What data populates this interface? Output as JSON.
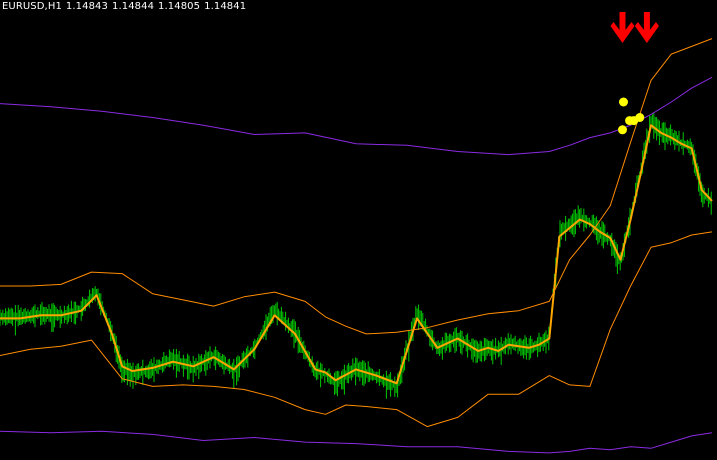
{
  "header": {
    "symbol_timeframe": "EURUSD,H1",
    "open": "1.14843",
    "high": "1.14844",
    "low": "1.14805",
    "close": "1.14841"
  },
  "colors": {
    "background": "#000000",
    "text": "#ffffff",
    "candles": "#00c800",
    "moving_average": "#ffa500",
    "inner_band": "#ff8c00",
    "outer_band": "#8a2be2",
    "dots": "#ffff00",
    "arrows": "#ff0000"
  },
  "chart_data": {
    "type": "line",
    "instrument": "EURUSD",
    "timeframe": "H1",
    "ylim": [
      1.1275,
      1.157
    ],
    "x_units": "bar index (H1 bars)",
    "xlim": [
      0,
      140
    ],
    "grid": false,
    "legend": "none",
    "series": [
      {
        "role": "price",
        "color": "#00c800",
        "x": [
          0,
          4,
          8,
          12,
          16,
          19,
          22,
          24,
          26,
          30,
          34,
          38,
          42,
          46,
          50,
          54,
          58,
          62,
          64,
          66,
          70,
          74,
          78,
          82,
          86,
          90,
          94,
          96,
          98,
          100,
          104,
          106,
          108,
          110,
          114,
          116,
          118,
          120,
          122,
          124,
          126,
          128,
          130,
          132,
          134,
          136,
          138,
          140
        ],
        "values": [
          1.1365,
          1.1365,
          1.1367,
          1.1366,
          1.137,
          1.1381,
          1.1355,
          1.1332,
          1.1328,
          1.1331,
          1.1338,
          1.1332,
          1.134,
          1.133,
          1.1345,
          1.137,
          1.1355,
          1.133,
          1.1328,
          1.1322,
          1.1332,
          1.1326,
          1.132,
          1.1368,
          1.1344,
          1.1352,
          1.1342,
          1.1345,
          1.1343,
          1.1348,
          1.1345,
          1.1347,
          1.1352,
          1.142,
          1.143,
          1.1426,
          1.142,
          1.1415,
          1.14,
          1.143,
          1.146,
          1.1492,
          1.1484,
          1.1482,
          1.1477,
          1.1475,
          1.1445,
          1.1439
        ]
      },
      {
        "role": "moving-average",
        "color": "#ffa500",
        "x": [
          0,
          4,
          8,
          12,
          16,
          19,
          22,
          24,
          26,
          30,
          34,
          38,
          42,
          46,
          50,
          54,
          58,
          62,
          64,
          66,
          70,
          74,
          78,
          82,
          86,
          90,
          94,
          96,
          98,
          100,
          104,
          106,
          108,
          110,
          114,
          116,
          118,
          120,
          122,
          124,
          126,
          128,
          130,
          132,
          134,
          136,
          138,
          140
        ],
        "values": [
          1.1364,
          1.1364,
          1.1366,
          1.1366,
          1.1369,
          1.1379,
          1.1354,
          1.1333,
          1.133,
          1.1332,
          1.1336,
          1.1333,
          1.1339,
          1.1331,
          1.1344,
          1.1366,
          1.1354,
          1.1331,
          1.1329,
          1.1324,
          1.1331,
          1.1327,
          1.1322,
          1.1364,
          1.1345,
          1.1351,
          1.1343,
          1.1345,
          1.1343,
          1.1347,
          1.1345,
          1.1347,
          1.1351,
          1.1417,
          1.1428,
          1.1425,
          1.142,
          1.1416,
          1.1402,
          1.1428,
          1.1458,
          1.1489,
          1.1484,
          1.1481,
          1.1477,
          1.1474,
          1.1447,
          1.144
        ]
      },
      {
        "role": "inner-band-upper",
        "color": "#ff8c00",
        "x": [
          0,
          6,
          12,
          18,
          24,
          30,
          36,
          42,
          48,
          54,
          60,
          64,
          68,
          72,
          78,
          84,
          90,
          96,
          102,
          108,
          112,
          116,
          120,
          124,
          128,
          132,
          136,
          140
        ],
        "values": [
          1.1385,
          1.1385,
          1.1386,
          1.1394,
          1.1393,
          1.138,
          1.1376,
          1.1372,
          1.1378,
          1.1381,
          1.1375,
          1.1365,
          1.1359,
          1.1354,
          1.1355,
          1.1358,
          1.1363,
          1.1367,
          1.1369,
          1.1375,
          1.1402,
          1.1418,
          1.1437,
          1.1478,
          1.1518,
          1.1535,
          1.154,
          1.1545
        ]
      },
      {
        "role": "inner-band-lower",
        "color": "#ff8c00",
        "x": [
          0,
          6,
          12,
          18,
          24,
          30,
          36,
          42,
          48,
          54,
          60,
          64,
          68,
          72,
          78,
          84,
          90,
          96,
          102,
          108,
          112,
          116,
          120,
          124,
          128,
          132,
          136,
          140
        ],
        "values": [
          1.134,
          1.1344,
          1.1346,
          1.135,
          1.1325,
          1.132,
          1.1321,
          1.132,
          1.1318,
          1.1313,
          1.1305,
          1.1302,
          1.1308,
          1.1307,
          1.1305,
          1.1294,
          1.13,
          1.1315,
          1.1315,
          1.1327,
          1.1321,
          1.132,
          1.1357,
          1.1385,
          1.141,
          1.1413,
          1.1418,
          1.142
        ]
      },
      {
        "role": "outer-band-upper",
        "color": "#8a2be2",
        "x": [
          0,
          10,
          20,
          30,
          40,
          50,
          60,
          70,
          80,
          90,
          100,
          108,
          112,
          116,
          120,
          124,
          128,
          132,
          136,
          140
        ],
        "values": [
          1.1503,
          1.1501,
          1.1498,
          1.1494,
          1.1489,
          1.1483,
          1.1484,
          1.1477,
          1.1476,
          1.1472,
          1.147,
          1.1472,
          1.1476,
          1.1481,
          1.1484,
          1.1489,
          1.1496,
          1.1504,
          1.1513,
          1.152
        ]
      },
      {
        "role": "outer-band-lower",
        "color": "#8a2be2",
        "x": [
          0,
          10,
          20,
          30,
          40,
          50,
          60,
          70,
          80,
          90,
          100,
          108,
          112,
          116,
          120,
          124,
          128,
          132,
          136,
          140
        ],
        "values": [
          1.1291,
          1.129,
          1.1291,
          1.1289,
          1.1285,
          1.1287,
          1.1284,
          1.1283,
          1.1281,
          1.1281,
          1.1278,
          1.1277,
          1.1278,
          1.128,
          1.1279,
          1.1281,
          1.128,
          1.1284,
          1.1288,
          1.129
        ]
      }
    ],
    "signals": {
      "dots": [
        {
          "x": 122.6,
          "y": 1.1504
        },
        {
          "x": 122.4,
          "y": 1.1486
        },
        {
          "x": 123.8,
          "y": 1.1492
        },
        {
          "x": 124.6,
          "y": 1.1492
        },
        {
          "x": 125.8,
          "y": 1.1494
        }
      ],
      "arrows": [
        {
          "x": 122.4,
          "direction": "down"
        },
        {
          "x": 127.2,
          "direction": "down"
        }
      ]
    }
  }
}
